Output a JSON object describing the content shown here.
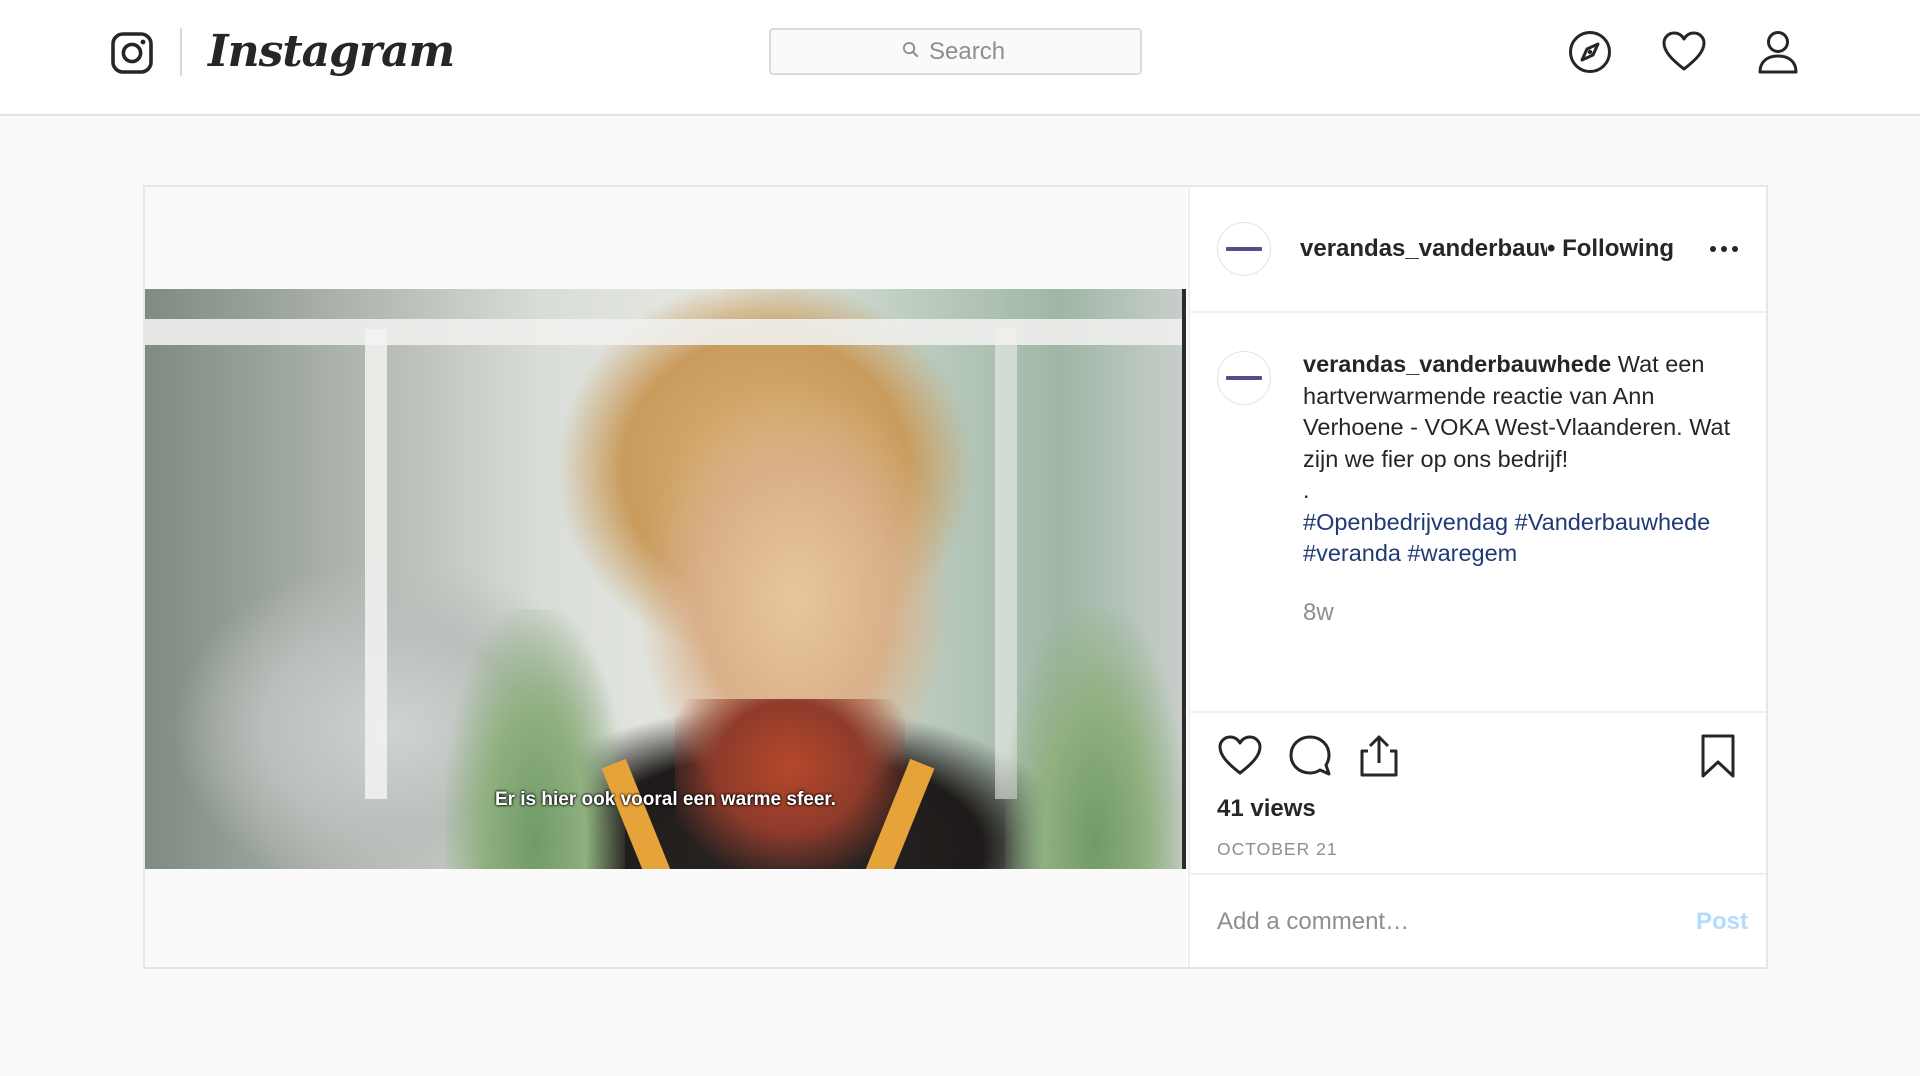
{
  "nav": {
    "brand": "Instagram",
    "search_placeholder": "Search",
    "icons": [
      "instagram-glyph-icon",
      "compass-icon",
      "heart-icon",
      "profile-icon"
    ]
  },
  "post": {
    "video_subtitle": "Er is hier ook vooral een warme sfeer.",
    "header": {
      "username": "verandas_vanderbauwhede",
      "follow_status": "• Following"
    },
    "caption": {
      "username": "verandas_vanderbauwhede",
      "text": "Wat een hartverwarmende reactie van Ann Verhoene - VOKA West-Vlaanderen. Wat zijn we fier op ons bedrijf!",
      "separator": ".",
      "hashtags_line1": "#Openbedrijvendag #Vanderbauwhede",
      "hashtags_line2": "#veranda #waregem"
    },
    "time_ago": "8w",
    "views": "41 views",
    "date": "OCTOBER 21",
    "comment_placeholder": "Add a comment…",
    "post_label": "Post"
  },
  "colors": {
    "hashtag": "#1f3a75",
    "muted": "#8e8e8e",
    "post_button_disabled": "#b3dbff"
  }
}
